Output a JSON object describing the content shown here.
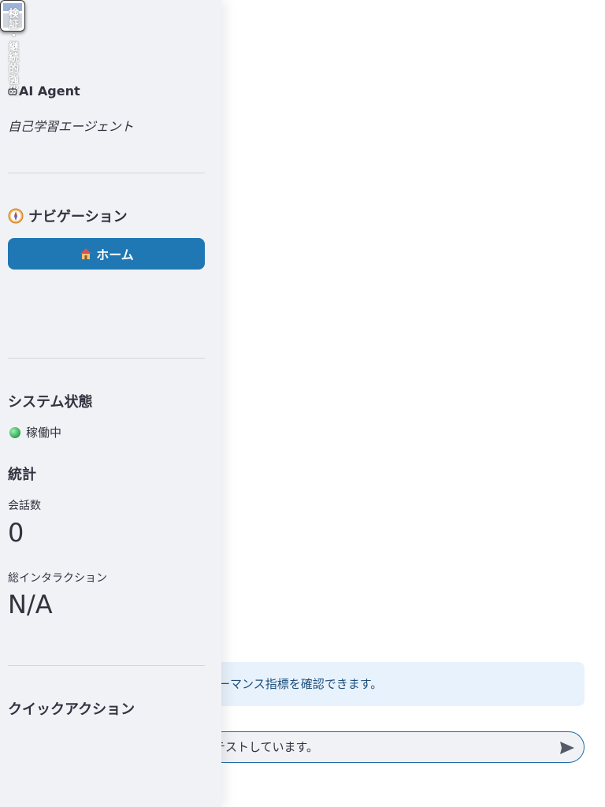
{
  "sidebar": {
    "logo_vertical_text": "検証・継続的強化",
    "agent_title": "AI Agent",
    "agent_subtitle": "自己学習エージェント",
    "navigation_heading": "ナビゲーション",
    "home_button_label": "ホーム",
    "system_status_heading": "システム状態",
    "status_text": "稼働中",
    "stats_heading": "統計",
    "conversations_label": "会話数",
    "conversations_value": "0",
    "total_interactions_label": "総インタラクション",
    "total_interactions_value": "N/A",
    "quick_actions_heading": "クイックアクション"
  },
  "main": {
    "info_text": "ォーマンス指標を確認できます。",
    "chat_input_value": "テストしています。"
  },
  "colors": {
    "primary_button": "#1f77b4",
    "sidebar_bg": "#f0f2f6",
    "info_bg": "#e8f2fc",
    "info_text": "#1d4f7c",
    "status_green": "#2ca44e"
  }
}
